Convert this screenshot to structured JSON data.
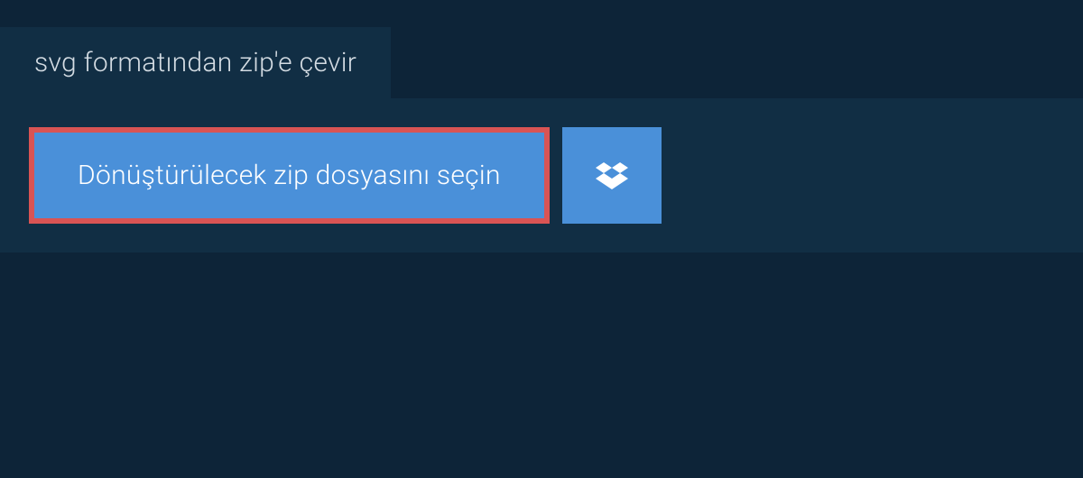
{
  "tab": {
    "label": "svg formatından zip'e çevir"
  },
  "upload": {
    "select_button_label": "Dönüştürülecek zip dosyasını seçin"
  },
  "colors": {
    "page_bg": "#0d2438",
    "panel_bg": "#112e44",
    "button_bg": "#4a90d9",
    "highlight_border": "#d95454",
    "text_light": "#d4dce3",
    "text_white": "#ffffff"
  }
}
